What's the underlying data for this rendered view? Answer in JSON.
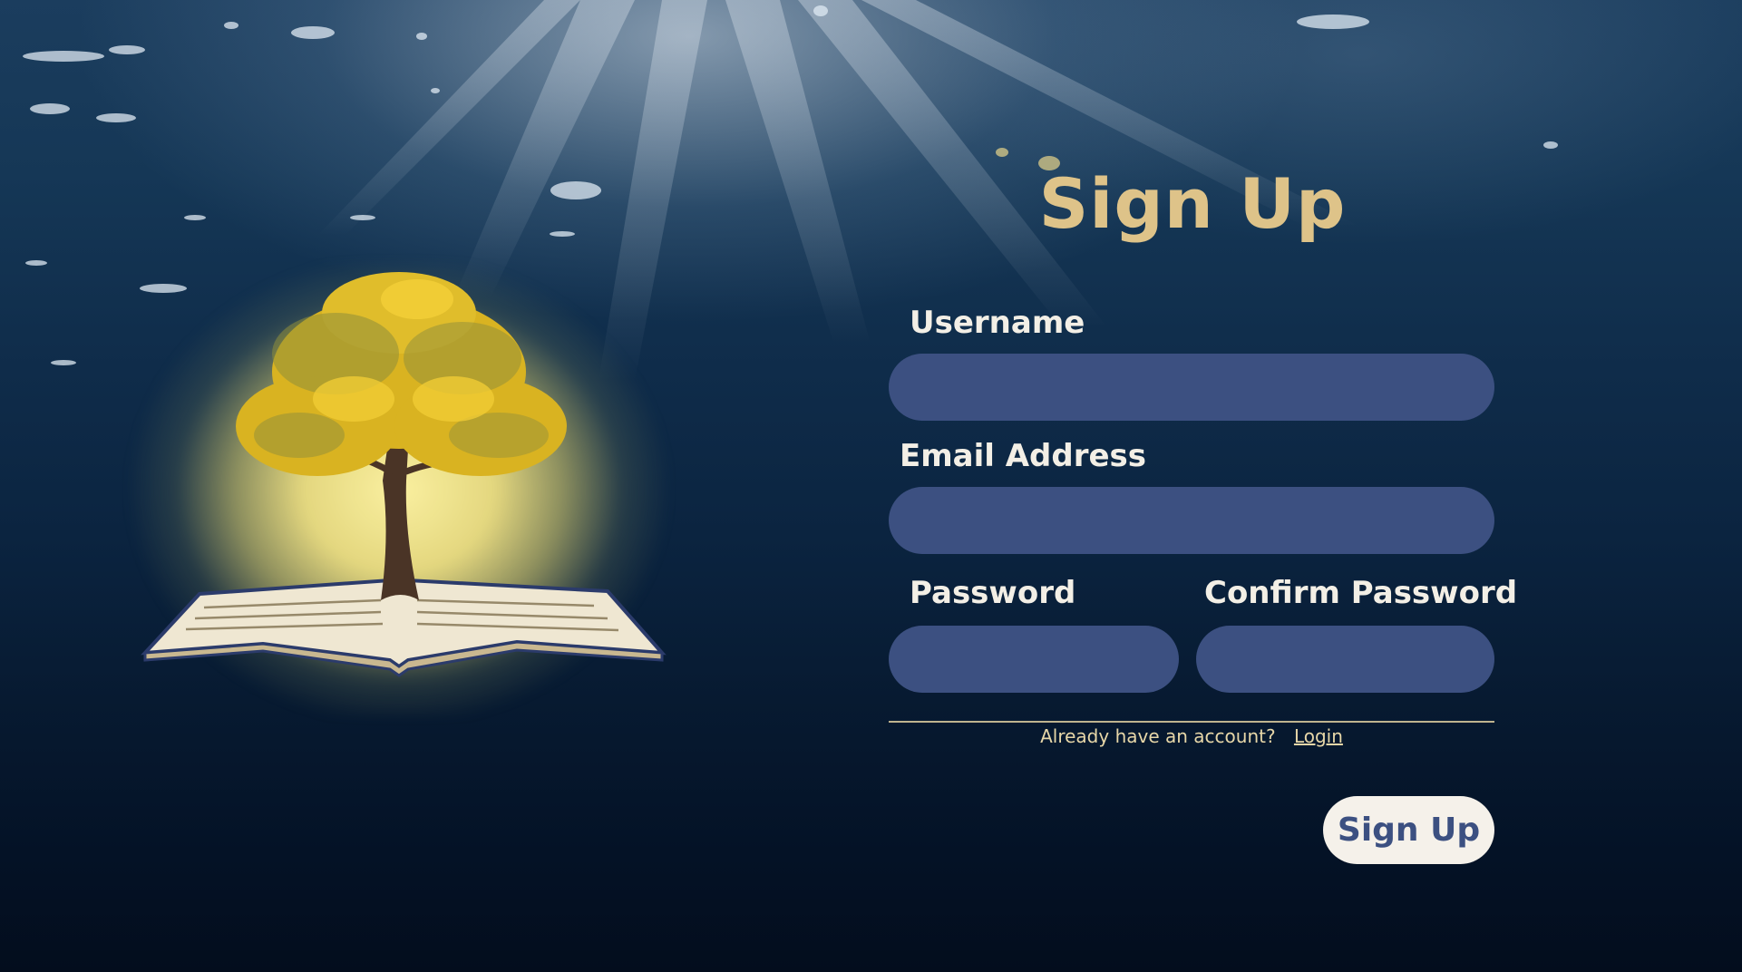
{
  "form": {
    "title": "Sign Up",
    "username_label": "Username",
    "username_value": "",
    "email_label": "Email Address",
    "email_value": "",
    "password_label": "Password",
    "password_value": "",
    "confirm_password_label": "Confirm Password",
    "confirm_password_value": "",
    "already_text": "Already have an account?",
    "login_link": "Login",
    "submit_label": "Sign Up"
  },
  "logo": {
    "icon": "tree-on-open-book-icon"
  },
  "colors": {
    "title": "#dec389",
    "label": "#f3efe6",
    "field_bg": "#3c5081",
    "button_bg": "#f5f1ea",
    "button_text": "#3c5081",
    "link": "#e7d7a8",
    "background_deep": "#041427"
  }
}
